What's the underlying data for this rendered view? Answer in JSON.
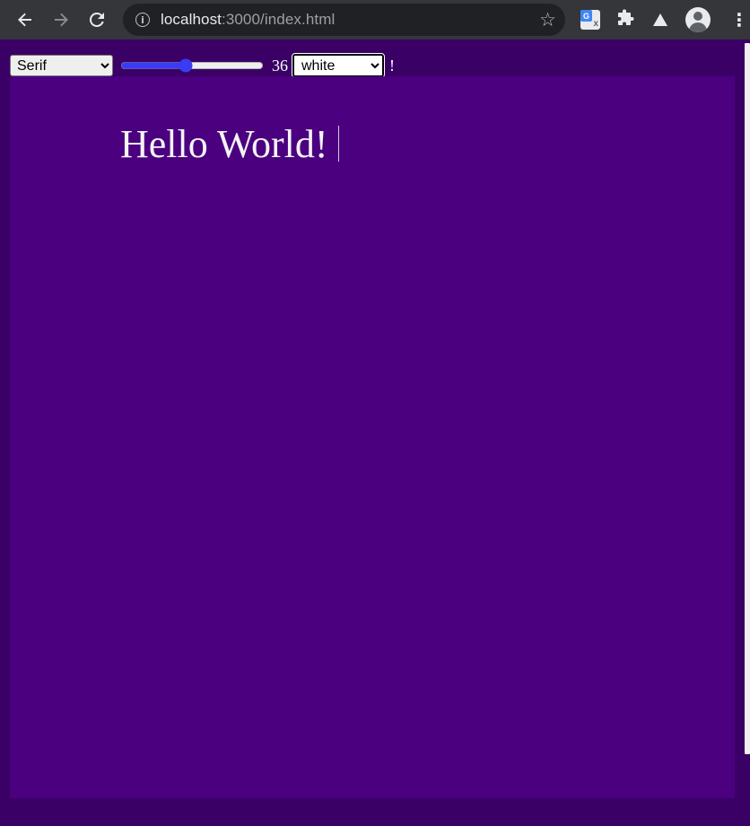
{
  "browser": {
    "url_host": "localhost",
    "url_rest": ":3000/index.html",
    "icons": [
      "back-arrow-icon",
      "forward-arrow-icon",
      "reload-icon",
      "site-info-icon",
      "bookmark-star-icon",
      "google-translate-icon",
      "extensions-puzzle-icon",
      "labs-flask-icon",
      "profile-avatar-icon",
      "kebab-menu-icon"
    ]
  },
  "controls": {
    "font_select_value": "Serif",
    "font_size_value": 36,
    "font_size_readout": "36",
    "font_size_percent": 45,
    "color_select_value": "white",
    "trailing_text": "!"
  },
  "canvas": {
    "text": "Hello World!",
    "background": "#4b0080",
    "text_color": "#ffffff"
  },
  "colors": {
    "page_background": "#3a0066",
    "canvas_background": "#4b0080",
    "browser_chrome": "#35363a",
    "omnibox": "#202124",
    "slider_accent": "#3b3bf5"
  }
}
